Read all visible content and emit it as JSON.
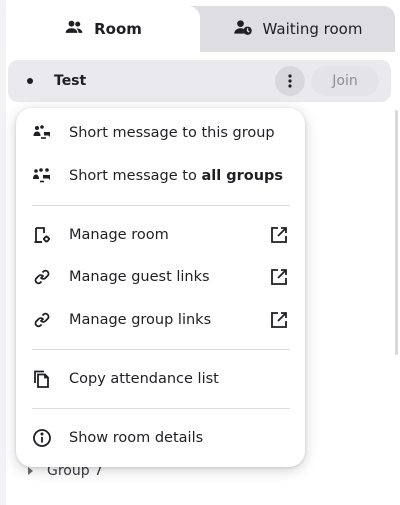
{
  "tabs": [
    {
      "label": "Room",
      "icon": "people-icon",
      "active": true
    },
    {
      "label": "Waiting room",
      "icon": "waiting-room-icon",
      "active": false
    }
  ],
  "group": {
    "name": "Test",
    "join_label": "Join",
    "join_disabled": true
  },
  "next_group": {
    "name": "Group 7"
  },
  "menu": {
    "items": [
      {
        "label": "Short message to this group",
        "icon": "group-message-icon"
      },
      {
        "label_prefix": "Short message to ",
        "label_bold": "all groups",
        "icon": "broadcast-message-icon"
      },
      {
        "label": "Manage room",
        "icon": "manage-room-icon",
        "external": true
      },
      {
        "label": "Manage guest links",
        "icon": "link-icon",
        "external": true
      },
      {
        "label": "Manage group links",
        "icon": "link-icon",
        "external": true
      },
      {
        "label": "Copy attendance list",
        "icon": "copy-icon"
      },
      {
        "label": "Show room details",
        "icon": "info-icon"
      }
    ]
  },
  "colors": {
    "background": "#f3f3f5",
    "tab_inactive": "#dedee2",
    "group_row": "#e9e9ee",
    "join_disabled_text": "#8e8e96"
  }
}
